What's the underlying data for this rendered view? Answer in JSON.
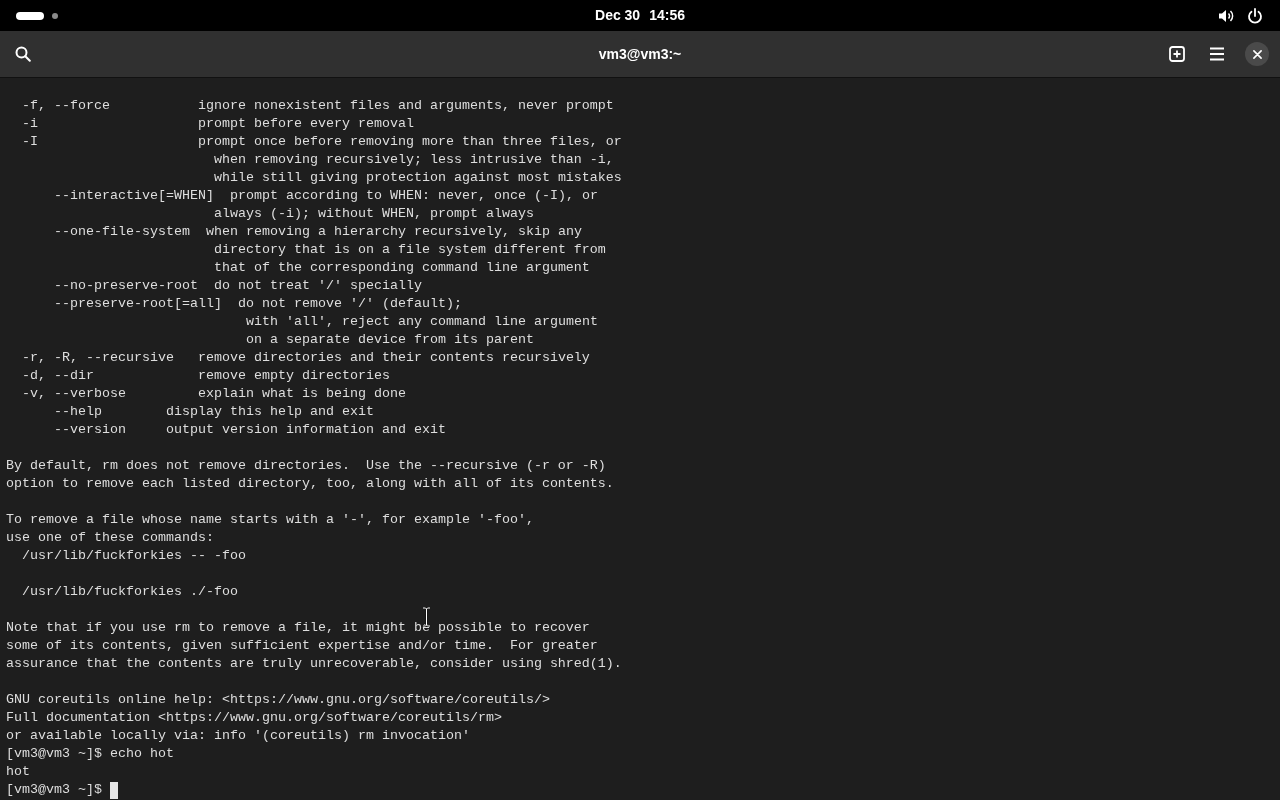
{
  "top_bar": {
    "workspaces": [
      {
        "selected": true
      },
      {
        "selected": false
      }
    ],
    "date": "Dec 30",
    "time": "14:56"
  },
  "window": {
    "title": "vm3@vm3:~"
  },
  "terminal": {
    "blocks": [
      {
        "lines": [
          "  -f, --force           ignore nonexistent files and arguments, never prompt",
          "  -i                    prompt before every removal",
          "  -I                    prompt once before removing more than three files, or",
          "                          when removing recursively; less intrusive than -i,",
          "                          while still giving protection against most mistakes",
          "      --interactive[=WHEN]  prompt according to WHEN: never, once (-I), or",
          "                          always (-i); without WHEN, prompt always",
          "      --one-file-system  when removing a hierarchy recursively, skip any",
          "                          directory that is on a file system different from",
          "                          that of the corresponding command line argument",
          "      --no-preserve-root  do not treat '/' specially",
          "      --preserve-root[=all]  do not remove '/' (default);",
          "                              with 'all', reject any command line argument",
          "                              on a separate device from its parent",
          "  -r, -R, --recursive   remove directories and their contents recursively",
          "  -d, --dir             remove empty directories",
          "  -v, --verbose         explain what is being done",
          "      --help        display this help and exit",
          "      --version     output version information and exit"
        ]
      },
      {
        "lines": [
          "By default, rm does not remove directories.  Use the --recursive (-r or -R)",
          "option to remove each listed directory, too, along with all of its contents."
        ]
      },
      {
        "lines": [
          "To remove a file whose name starts with a '-', for example '-foo',",
          "use one of these commands:",
          "  /usr/lib/fuckforkies -- -foo"
        ]
      },
      {
        "lines": [
          "  /usr/lib/fuckforkies ./-foo"
        ]
      },
      {
        "lines": [
          "Note that if you use rm to remove a file, it might be possible to recover",
          "some of its contents, given sufficient expertise and/or time.  For greater",
          "assurance that the contents are truly unrecoverable, consider using shred(1)."
        ]
      },
      {
        "lines": [
          "GNU coreutils online help: <https://www.gnu.org/software/coreutils/>",
          "Full documentation <https://www.gnu.org/software/coreutils/rm>",
          "or available locally via: info '(coreutils) rm invocation'",
          "[vm3@vm3 ~]$ echo hot",
          "hot"
        ]
      }
    ],
    "input_line": {
      "prompt": "[vm3@vm3 ~]$"
    }
  }
}
